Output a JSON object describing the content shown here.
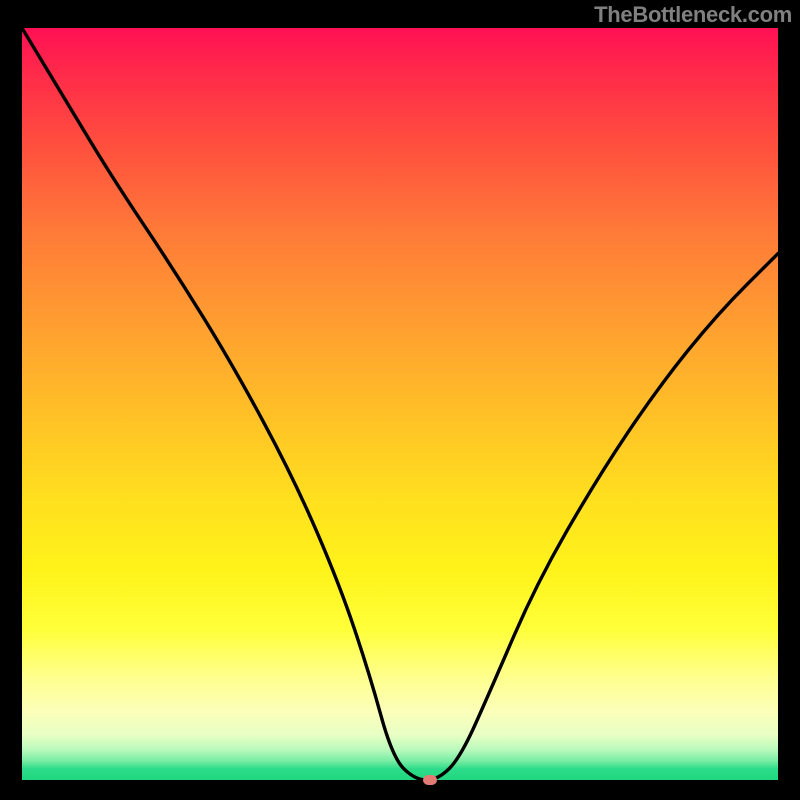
{
  "attribution": "TheBottleneck.com",
  "chart_data": {
    "type": "line",
    "title": "",
    "xlabel": "",
    "ylabel": "",
    "xlim": [
      0,
      100
    ],
    "ylim": [
      0,
      100
    ],
    "series": [
      {
        "name": "curve",
        "x": [
          0,
          6,
          12,
          20,
          28,
          36,
          42,
          46,
          49,
          52,
          55,
          58,
          62,
          68,
          76,
          84,
          92,
          100
        ],
        "y": [
          100,
          90,
          80,
          68,
          55,
          40,
          26,
          14,
          3,
          0,
          0,
          3,
          12,
          26,
          40,
          52,
          62,
          70
        ]
      }
    ],
    "marker": {
      "x": 54,
      "y": 0
    },
    "gradient_stops": [
      {
        "pos": 0,
        "color": "#ff1054"
      },
      {
        "pos": 0.5,
        "color": "#ffc226"
      },
      {
        "pos": 0.8,
        "color": "#ffff3a"
      },
      {
        "pos": 1.0,
        "color": "#1fd77f"
      }
    ]
  }
}
